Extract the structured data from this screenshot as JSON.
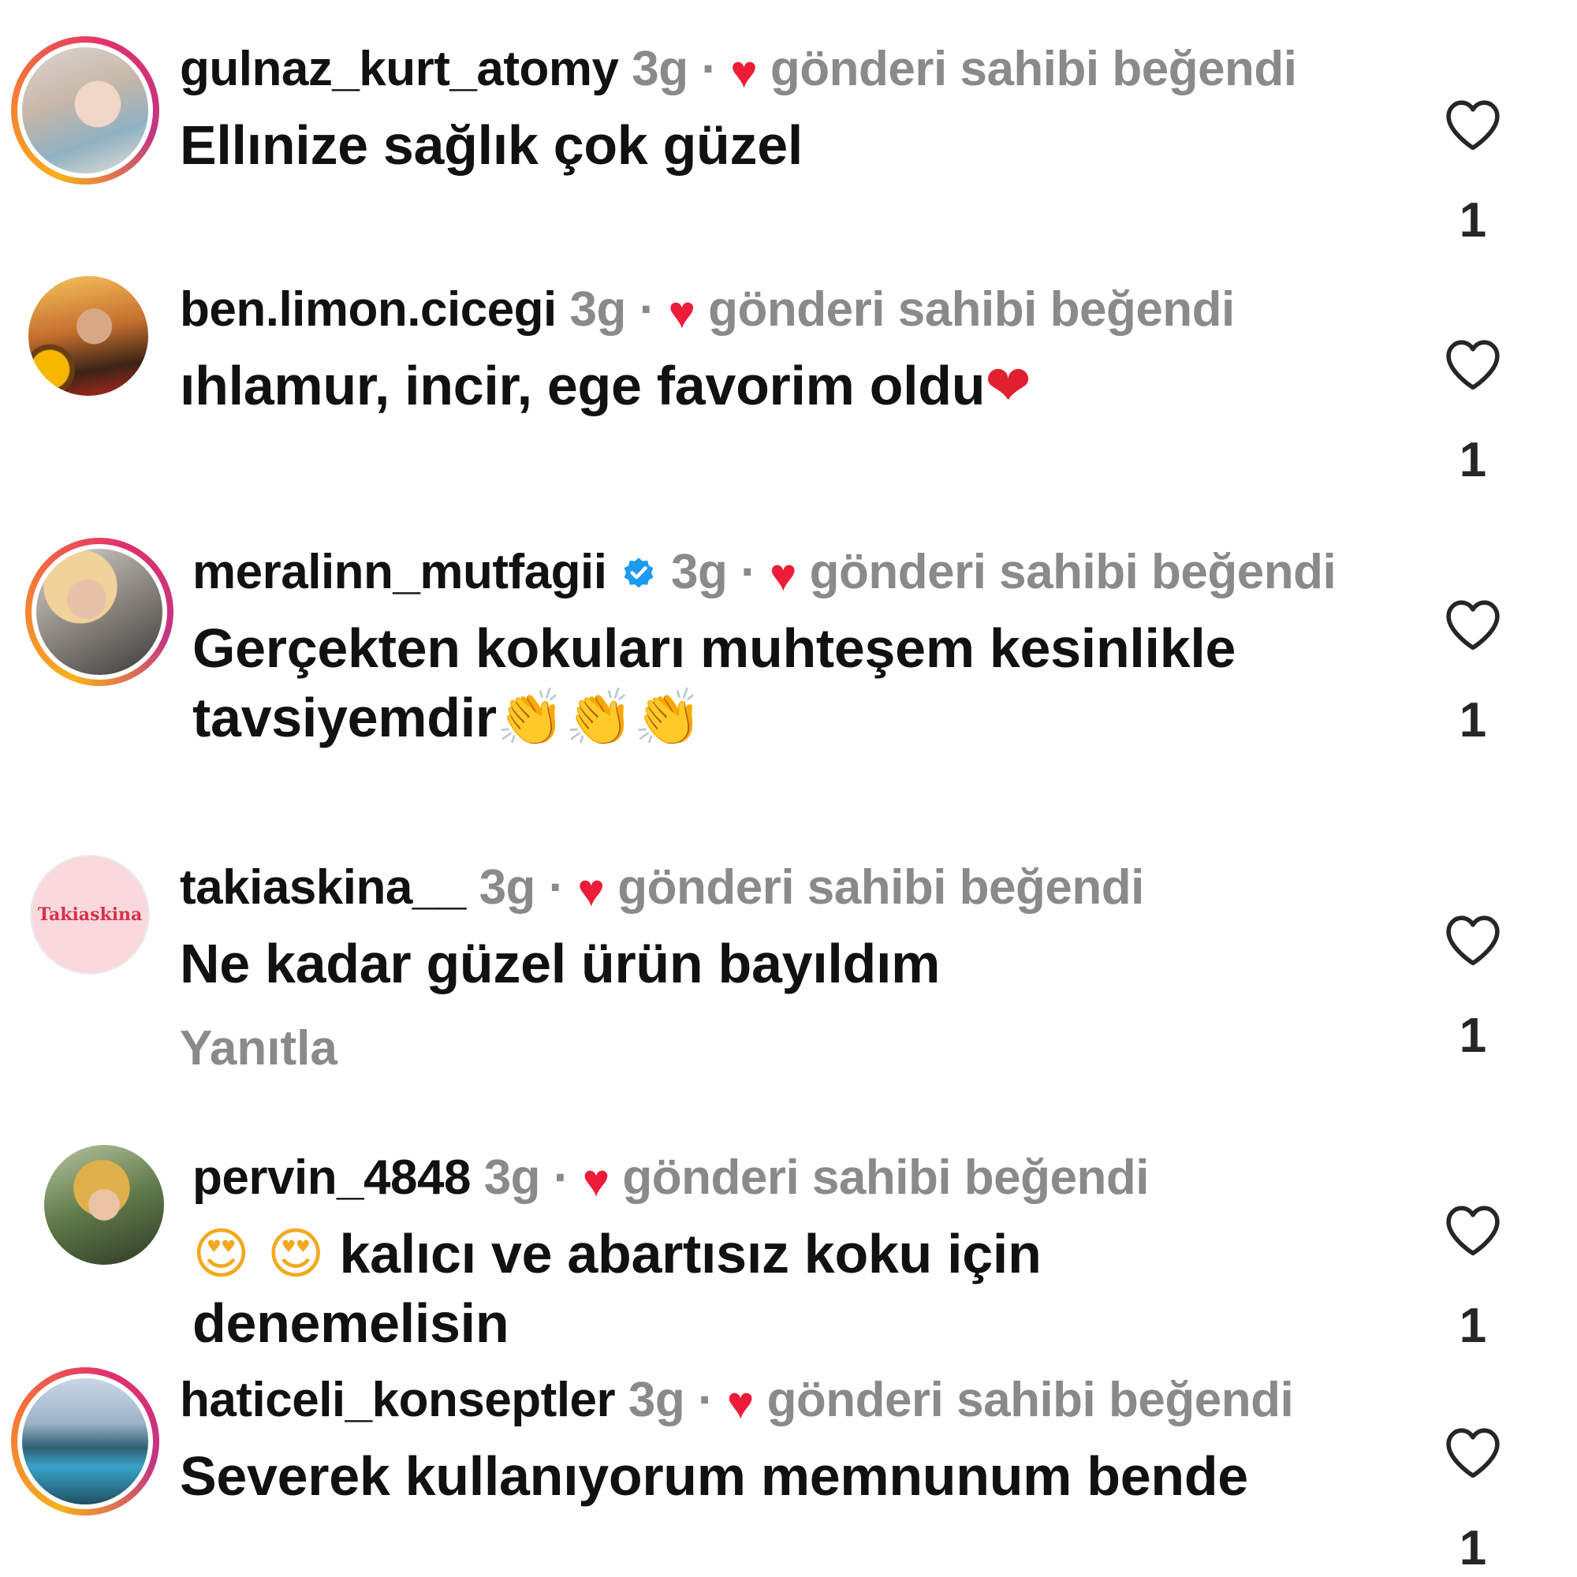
{
  "colors": {
    "liked_heart": "#ed1c38",
    "muted_text": "#8a8a8a",
    "primary_text": "#111111",
    "verified_blue": "#1d9bf0",
    "story_ring": [
      "#f7b01d",
      "#f77737",
      "#e1306c",
      "#c13584"
    ]
  },
  "icons": {
    "like_button": "heart-outline-icon",
    "liked_indicator": "heart-filled-icon",
    "verified_badge": "verified-badge-icon"
  },
  "comments": [
    {
      "username": "gulnaz_kurt_atomy",
      "time": "3g",
      "separator": "·",
      "liked_by_author": "gönderi sahibi beğendi",
      "text": "Ellınize sağlık çok güzel",
      "like_count": "1"
    },
    {
      "username": "ben.limon.cicegi",
      "time": "3g",
      "separator": "·",
      "liked_by_author": "gönderi sahibi beğendi",
      "text": "ıhlamur, incir, ege favorim oldu",
      "text_emoji": "❤",
      "like_count": "1"
    },
    {
      "username": "meralinn_mutfagii",
      "verified": true,
      "time": "3g",
      "separator": "·",
      "liked_by_author": "gönderi sahibi beğendi",
      "text": "Gerçekten kokuları muhteşem kesinlikle tavsiyemdir",
      "text_emoji": "👏👏👏",
      "like_count": "1"
    },
    {
      "username": "takiaskina__",
      "avatar_text": "Takiaskina",
      "time": "3g",
      "separator": "·",
      "liked_by_author": "gönderi sahibi beğendi",
      "text": "Ne kadar güzel ürün bayıldım",
      "reply_label": "Yanıtla",
      "like_count": "1"
    },
    {
      "username": "pervin_4848",
      "time": "3g",
      "separator": "·",
      "liked_by_author": "gönderi sahibi beğendi",
      "text_emoji": "😍 😍",
      "text": "kalıcı ve abartısız koku için denemelisin",
      "like_count": "1"
    },
    {
      "username": "haticeli_konseptler",
      "time": "3g",
      "separator": "·",
      "liked_by_author": "gönderi sahibi beğendi",
      "text": "Severek kullanıyorum memnunum bende",
      "like_count": "1"
    }
  ]
}
